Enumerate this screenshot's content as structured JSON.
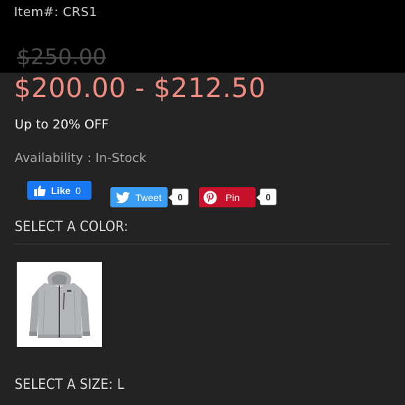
{
  "product": {
    "item_number": "Item#: CRS1",
    "original_price": "$250.00",
    "price_range": "$200.00 - $212.50",
    "discount": "Up to 20% OFF",
    "availability": "Availability : In-Stock"
  },
  "social": {
    "like_label": "Like",
    "like_count": "0",
    "tweet_label": "Tweet",
    "tweet_count": "0",
    "pin_label": "Pin",
    "pin_count": "0",
    "facebook_color": "#1877f2",
    "twitter_color": "#3a9df2",
    "pinterest_color": "#c8112b"
  },
  "color_select": {
    "label": "SELECT A COLOR:",
    "options": [
      {
        "icon": "grey-hooded-jacket-image"
      }
    ]
  },
  "size_select": {
    "label": "SELECT A SIZE:",
    "selected": "L"
  },
  "theme": {
    "background": "#232323",
    "price_color": "#f08c82"
  }
}
